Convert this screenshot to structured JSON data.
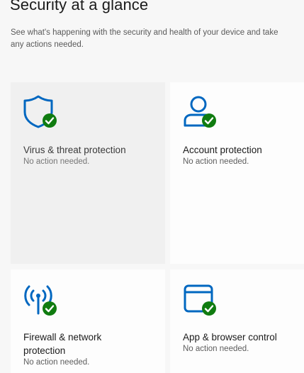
{
  "page": {
    "title": "Security at a glance",
    "subtitle": "See what's happening with the security and health of your device and take any actions needed."
  },
  "colors": {
    "accent": "#0067c0",
    "ok_badge": "#107c10",
    "selected_tile": "#f0f0f0",
    "tile": "#fdfdfd"
  },
  "tiles": [
    {
      "title": "Virus & threat protection",
      "status": "No action needed.",
      "icon": "shield-icon",
      "badge": "check-badge-icon",
      "selected": true
    },
    {
      "title": "Account protection",
      "status": "No action needed.",
      "icon": "person-icon",
      "badge": "check-badge-icon",
      "selected": false
    },
    {
      "title": "Firewall & network protection",
      "status": "No action needed.",
      "icon": "wifi-signal-icon",
      "badge": "check-badge-icon",
      "selected": false
    },
    {
      "title": "App & browser control",
      "status": "No action needed.",
      "icon": "browser-window-icon",
      "badge": "check-badge-icon",
      "selected": false
    }
  ]
}
